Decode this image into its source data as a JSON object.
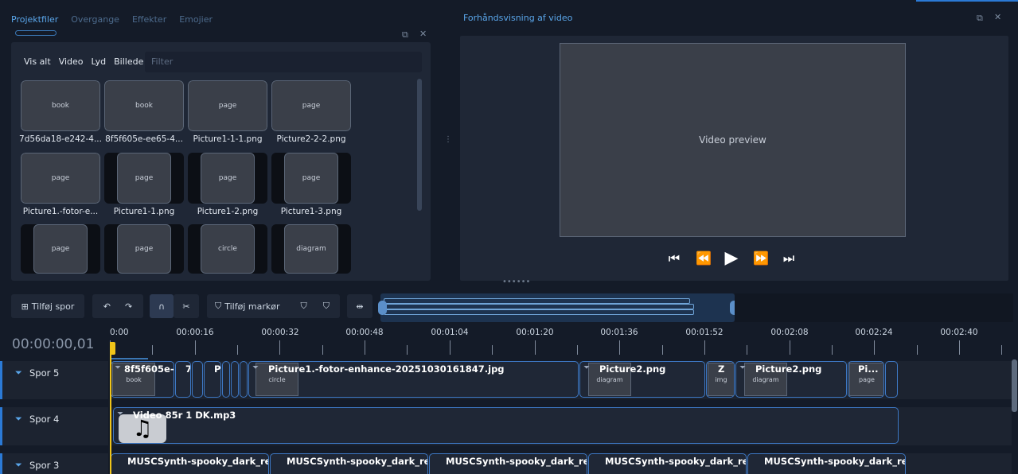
{
  "left_panel": {
    "tabs": [
      "Projektfiler",
      "Overgange",
      "Effekter",
      "Emojier"
    ],
    "filters": [
      "Vis alt",
      "Video",
      "Lyd",
      "Billede"
    ],
    "filter_placeholder": "Filter",
    "thumbnails": [
      {
        "label": "7d56da18-e242-4..."
      },
      {
        "label": "8f5f605e-ee65-4..."
      },
      {
        "label": "Picture1-1-1.png"
      },
      {
        "label": "Picture2-2-2.png"
      },
      {
        "label": "Picture1.-fotor-e..."
      },
      {
        "label": "Picture1-1.png"
      },
      {
        "label": "Picture1-2.png"
      },
      {
        "label": "Picture1-3.png"
      },
      {
        "label": ""
      },
      {
        "label": ""
      },
      {
        "label": ""
      },
      {
        "label": ""
      }
    ]
  },
  "preview": {
    "title": "Forhåndsvisning af video"
  },
  "toolbar": {
    "add_track": "Tilføj spor",
    "add_marker": "Tilføj markør"
  },
  "timeline": {
    "timecode": "00:00:00,01",
    "ruler_labels": [
      "0:00",
      "00:00:16",
      "00:00:32",
      "00:00:48",
      "00:01:04",
      "00:01:20",
      "00:01:36",
      "00:01:52",
      "00:02:08",
      "00:02:24",
      "00:02:40"
    ],
    "tracks": [
      {
        "name": "Spor 5",
        "clips": [
          "8f5f605e-...",
          "7",
          "P",
          "Picture1.-fotor-enhance-20251030161847.jpg",
          "Picture2.png",
          "Z",
          "Picture2.png",
          "Pi..."
        ]
      },
      {
        "name": "Spor 4",
        "clips": [
          "Video 85r 1 DK.mp3"
        ]
      },
      {
        "name": "Spor 3",
        "clips": [
          "MUSCSynth-spooky_dark_re...",
          "MUSCSynth-spooky_dark_re...",
          "MUSCSynth-spooky_dark_re...",
          "MUSCSynth-spooky_dark_re...",
          "MUSCSynth-spooky_dark_re..."
        ]
      }
    ]
  }
}
